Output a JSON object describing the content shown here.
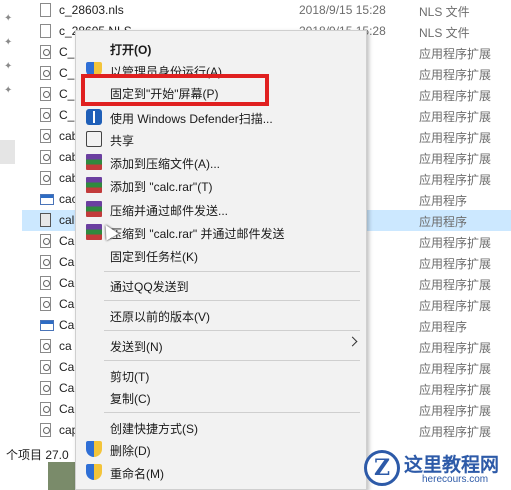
{
  "files": [
    {
      "name": "c_28603.nls",
      "date": "2018/9/15 15:28",
      "type": "NLS 文件",
      "icon": "file-icon"
    },
    {
      "name": "c_28605.NLS",
      "date": "2018/9/15 15:28",
      "type": "NLS 文件",
      "icon": "file-icon"
    },
    {
      "name": "C_",
      "date": "15:28",
      "type": "应用程序扩展",
      "icon": "dll-icon"
    },
    {
      "name": "C_",
      "date": "15:28",
      "type": "应用程序扩展",
      "icon": "dll-icon"
    },
    {
      "name": "C_",
      "date": "15:28",
      "type": "应用程序扩展",
      "icon": "dll-icon"
    },
    {
      "name": "C_",
      "date": "15:28",
      "type": "应用程序扩展",
      "icon": "dll-icon"
    },
    {
      "name": "cab",
      "date": "15:28",
      "type": "应用程序扩展",
      "icon": "dll-icon"
    },
    {
      "name": "cab",
      "date": "15:28",
      "type": "应用程序扩展",
      "icon": "dll-icon"
    },
    {
      "name": "cab",
      "date": "15:28",
      "type": "应用程序扩展",
      "icon": "dll-icon"
    },
    {
      "name": "cac",
      "date": "15:28",
      "type": "应用程序",
      "icon": "exe-icon"
    },
    {
      "name": "cal",
      "date": "15:29",
      "type": "应用程序",
      "icon": "calculator-icon",
      "selected": true
    },
    {
      "name": "Ca",
      "date": "15:28",
      "type": "应用程序扩展",
      "icon": "dll-icon"
    },
    {
      "name": "Ca",
      "date": "15:28",
      "type": "应用程序扩展",
      "icon": "dll-icon"
    },
    {
      "name": "Ca",
      "date": "15:28",
      "type": "应用程序扩展",
      "icon": "dll-icon"
    },
    {
      "name": "Ca",
      "date": ":44",
      "type": "应用程序扩展",
      "icon": "dll-icon"
    },
    {
      "name": "Ca",
      "date": ":06",
      "type": "应用程序",
      "icon": "exe-icon"
    },
    {
      "name": "ca",
      "date": "15:28",
      "type": "应用程序扩展",
      "icon": "dll-icon"
    },
    {
      "name": "Ca",
      "date": "15:28",
      "type": "应用程序扩展",
      "icon": "dll-icon"
    },
    {
      "name": "Ca",
      "date": ":44",
      "type": "应用程序扩展",
      "icon": "dll-icon"
    },
    {
      "name": "Ca",
      "date": ":44",
      "type": "应用程序扩展",
      "icon": "dll-icon"
    },
    {
      "name": "cap",
      "date": "15:28",
      "type": "应用程序扩展",
      "icon": "dll-icon"
    }
  ],
  "status": {
    "text": "个项目  27.0"
  },
  "menu": {
    "open": "打开(O)",
    "run_as_admin": "以管理员身份运行(A)",
    "pin_start": "固定到\"开始\"屏幕(P)",
    "defender": "使用 Windows Defender扫描...",
    "share": "共享",
    "add_archive": "添加到压缩文件(A)...",
    "add_rar": "添加到 \"calc.rar\"(T)",
    "compress_email": "压缩并通过邮件发送...",
    "compress_rar_email": "压缩到 \"calc.rar\" 并通过邮件发送",
    "pin_taskbar": "固定到任务栏(K)",
    "send_qq": "通过QQ发送到",
    "restore_prev": "还原以前的版本(V)",
    "send_to": "发送到(N)",
    "cut": "剪切(T)",
    "copy": "复制(C)",
    "create_shortcut": "创建快捷方式(S)",
    "delete": "删除(D)",
    "rename": "重命名(M)"
  },
  "watermark": {
    "logo": "Z",
    "title": "这里教程网",
    "url": "herecours.com"
  },
  "colors": {
    "selection": "#cce8ff",
    "highlight_box": "#e02020",
    "brand": "#2d5aa8"
  }
}
